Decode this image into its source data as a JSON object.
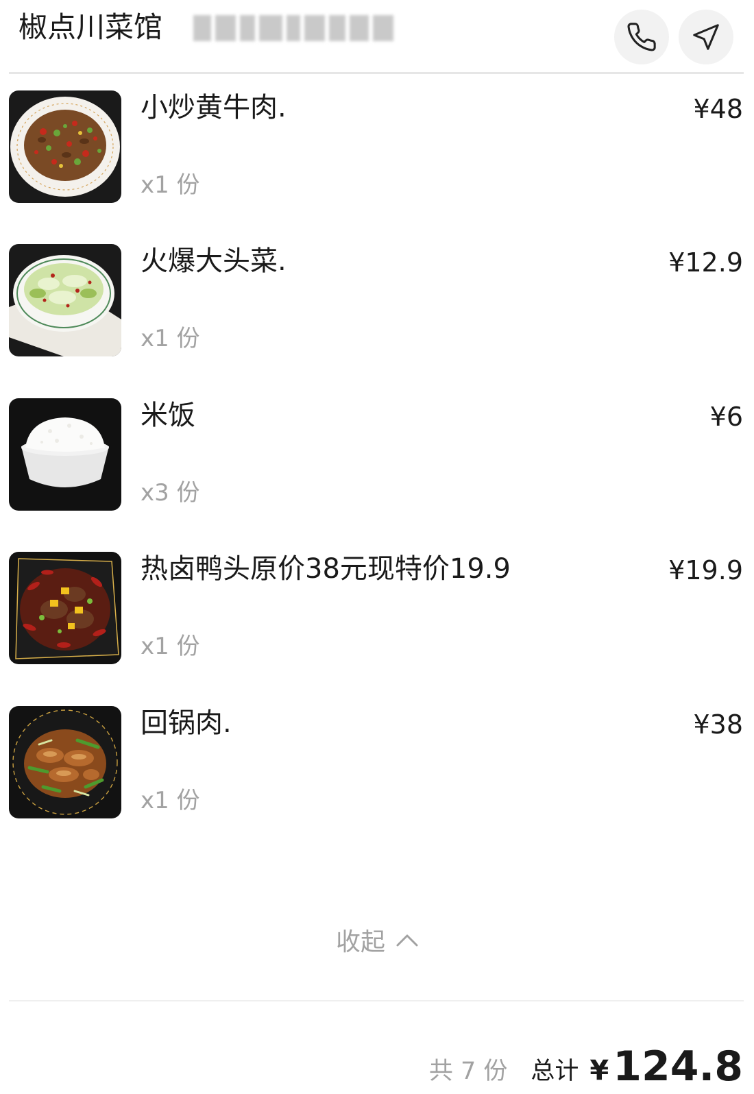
{
  "header": {
    "store_name": "椒点川菜馆",
    "phone_icon": "phone-icon",
    "navigate_icon": "navigate-arrow-icon"
  },
  "items": [
    {
      "name": "小炒黄牛肉.",
      "quantity": "x1 份",
      "price": "¥48",
      "image": "stir-fried-beef-dish-photo"
    },
    {
      "name": "火爆大头菜.",
      "quantity": "x1 份",
      "price": "¥12.9",
      "image": "stir-fried-cabbage-dish-photo"
    },
    {
      "name": "米饭",
      "quantity": "x3 份",
      "price": "¥6",
      "image": "rice-bowl-photo"
    },
    {
      "name": "热卤鸭头原价38元现特价19.9",
      "quantity": "x1 份",
      "price": "¥19.9",
      "image": "spicy-duck-head-dish-photo"
    },
    {
      "name": "回锅肉.",
      "quantity": "x1 份",
      "price": "¥38",
      "image": "twice-cooked-pork-dish-photo"
    }
  ],
  "collapse": {
    "label": "收起",
    "icon": "chevron-up-icon"
  },
  "summary": {
    "count_text": "共 7 份",
    "total_label": "总计",
    "currency": "¥",
    "total_amount": "124.8"
  },
  "colors": {
    "primary_text": "#1a1a1a",
    "secondary_text": "#a2a2a2",
    "divider": "#e6e6e6",
    "icon_button_bg": "#f2f2f2"
  }
}
